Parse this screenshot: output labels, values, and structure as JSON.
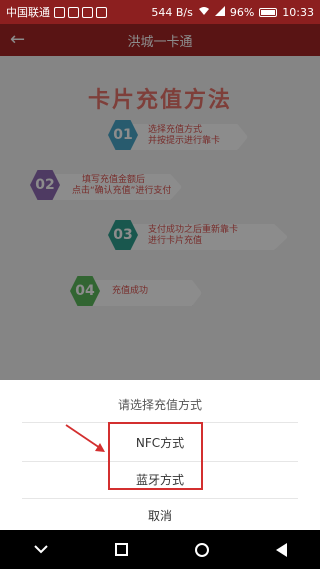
{
  "status_bar": {
    "carrier": "中国联通",
    "speed": "544 B/s",
    "battery": "96%",
    "time": "10:33"
  },
  "titlebar": {
    "back_icon": "←",
    "title": "洪城一卡通"
  },
  "guide": {
    "heading": "卡片充值方法",
    "steps": [
      {
        "num": "01",
        "line1": "选择充值方式",
        "line2": "并按提示进行靠卡",
        "color": "#4aa6c9"
      },
      {
        "num": "02",
        "line1": "填写充值金额后",
        "line2": "点击“确认充值”进行支付",
        "color": "#8e6bb3"
      },
      {
        "num": "03",
        "line1": "支付成功之后重新靠卡",
        "line2": "进行卡片充值",
        "color": "#2f9f8f"
      },
      {
        "num": "04",
        "line1": "充值成功",
        "line2": "",
        "color": "#5cb85c"
      }
    ]
  },
  "sheet": {
    "title": "请选择充值方式",
    "option_nfc": "NFC方式",
    "option_bluetooth": "蓝牙方式",
    "cancel": "取消"
  },
  "colors": {
    "accent": "#a32626",
    "highlight": "#d32f2f"
  }
}
